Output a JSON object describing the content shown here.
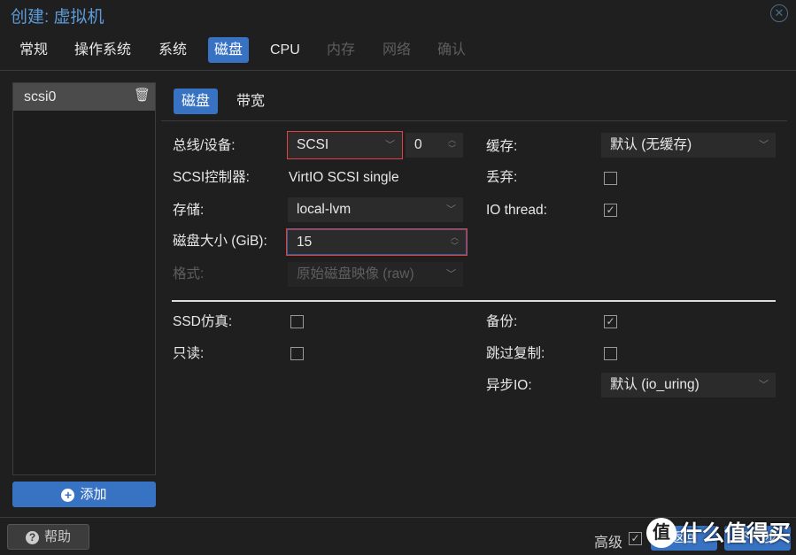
{
  "window": {
    "title": "创建: 虚拟机",
    "close_icon": "close-circle-icon"
  },
  "tabs": [
    {
      "label": "常规"
    },
    {
      "label": "操作系统"
    },
    {
      "label": "系统"
    },
    {
      "label": "磁盘",
      "active": true
    },
    {
      "label": "CPU"
    },
    {
      "label": "内存",
      "disabled": true
    },
    {
      "label": "网络",
      "disabled": true
    },
    {
      "label": "确认",
      "disabled": true
    }
  ],
  "disk_list": {
    "items": [
      {
        "label": "scsi0",
        "selected": true
      }
    ],
    "delete_icon": "trash-icon",
    "add_label": "添加"
  },
  "subtabs": [
    {
      "label": "磁盘",
      "active": true
    },
    {
      "label": "带宽"
    }
  ],
  "form": {
    "bus_label": "总线/设备:",
    "bus_value": "SCSI",
    "device_value": "0",
    "controller_label": "SCSI控制器:",
    "controller_value": "VirtIO SCSI single",
    "storage_label": "存储:",
    "storage_value": "local-lvm",
    "size_label": "磁盘大小 (GiB):",
    "size_value": "15",
    "format_label": "格式:",
    "format_value": "原始磁盘映像 (raw)",
    "cache_label": "缓存:",
    "cache_value": "默认 (无缓存)",
    "discard_label": "丢弃:",
    "discard_checked": false,
    "iothread_label": "IO thread:",
    "iothread_checked": true,
    "ssd_label": "SSD仿真:",
    "ssd_checked": false,
    "readonly_label": "只读:",
    "readonly_checked": false,
    "backup_label": "备份:",
    "backup_checked": true,
    "skiprep_label": "跳过复制:",
    "skiprep_checked": false,
    "asyncio_label": "异步IO:",
    "asyncio_value": "默认 (io_uring)"
  },
  "footer": {
    "help_label": "帮助",
    "advanced_label": "高级",
    "advanced_checked": true,
    "back_label": "返回",
    "next_label": "下一步"
  },
  "watermark": {
    "text": "什么值得买",
    "logo": "值"
  },
  "colors": {
    "accent": "#3873c3",
    "title": "#5d9bd8",
    "highlight": "#e04040"
  }
}
